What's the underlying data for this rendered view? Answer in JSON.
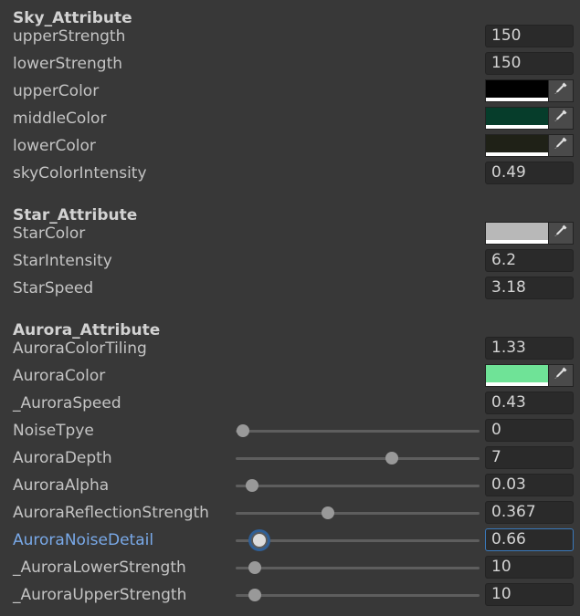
{
  "sky": {
    "title": "Sky_Attribute",
    "upper_strength": {
      "label": "upperStrength",
      "value": "150"
    },
    "lower_strength": {
      "label": "lowerStrength",
      "value": "150"
    },
    "upper_color": {
      "label": "upperColor",
      "color": "#000000"
    },
    "middle_color": {
      "label": "middleColor",
      "color": "#063d2b"
    },
    "lower_color": {
      "label": "lowerColor",
      "color": "#1f2117"
    },
    "sky_color_intensity": {
      "label": "skyColorIntensity",
      "value": "0.49"
    }
  },
  "star": {
    "title": "Star_Attribute",
    "star_color": {
      "label": "StarColor",
      "color": "#b8b8b8"
    },
    "star_intensity": {
      "label": "StarIntensity",
      "value": "6.2"
    },
    "star_speed": {
      "label": "StarSpeed",
      "value": "3.18"
    }
  },
  "aurora": {
    "title": "Aurora_Attribute",
    "color_tiling": {
      "label": "AuroraColorTiling",
      "value": "1.33"
    },
    "aurora_color": {
      "label": "AuroraColor",
      "color": "#6fe397"
    },
    "aurora_speed": {
      "label": "_AuroraSpeed",
      "value": "0.43"
    },
    "noise_type": {
      "label": "NoiseTpye",
      "value": "0",
      "fraction": 0.0
    },
    "depth": {
      "label": "AuroraDepth",
      "value": "7",
      "fraction": 0.65
    },
    "alpha": {
      "label": "AuroraAlpha",
      "value": "0.03",
      "fraction": 0.04
    },
    "reflection_strength": {
      "label": "AuroraReflectionStrength",
      "value": "0.367",
      "fraction": 0.37
    },
    "noise_detail": {
      "label": "AuroraNoiseDetail",
      "value": "0.66",
      "fraction": 0.07
    },
    "lower_strength": {
      "label": "_AuroraLowerStrength",
      "value": "10",
      "fraction": 0.05
    },
    "upper_strength": {
      "label": "_AuroraUpperStrength",
      "value": "10",
      "fraction": 0.05
    }
  },
  "icons": {
    "picker": "eyedropper-icon"
  },
  "colors": {
    "background": "#383838",
    "field_background": "#2a2a2a",
    "focus_accent": "#3a79bb",
    "active_label": "#79a9e8"
  }
}
